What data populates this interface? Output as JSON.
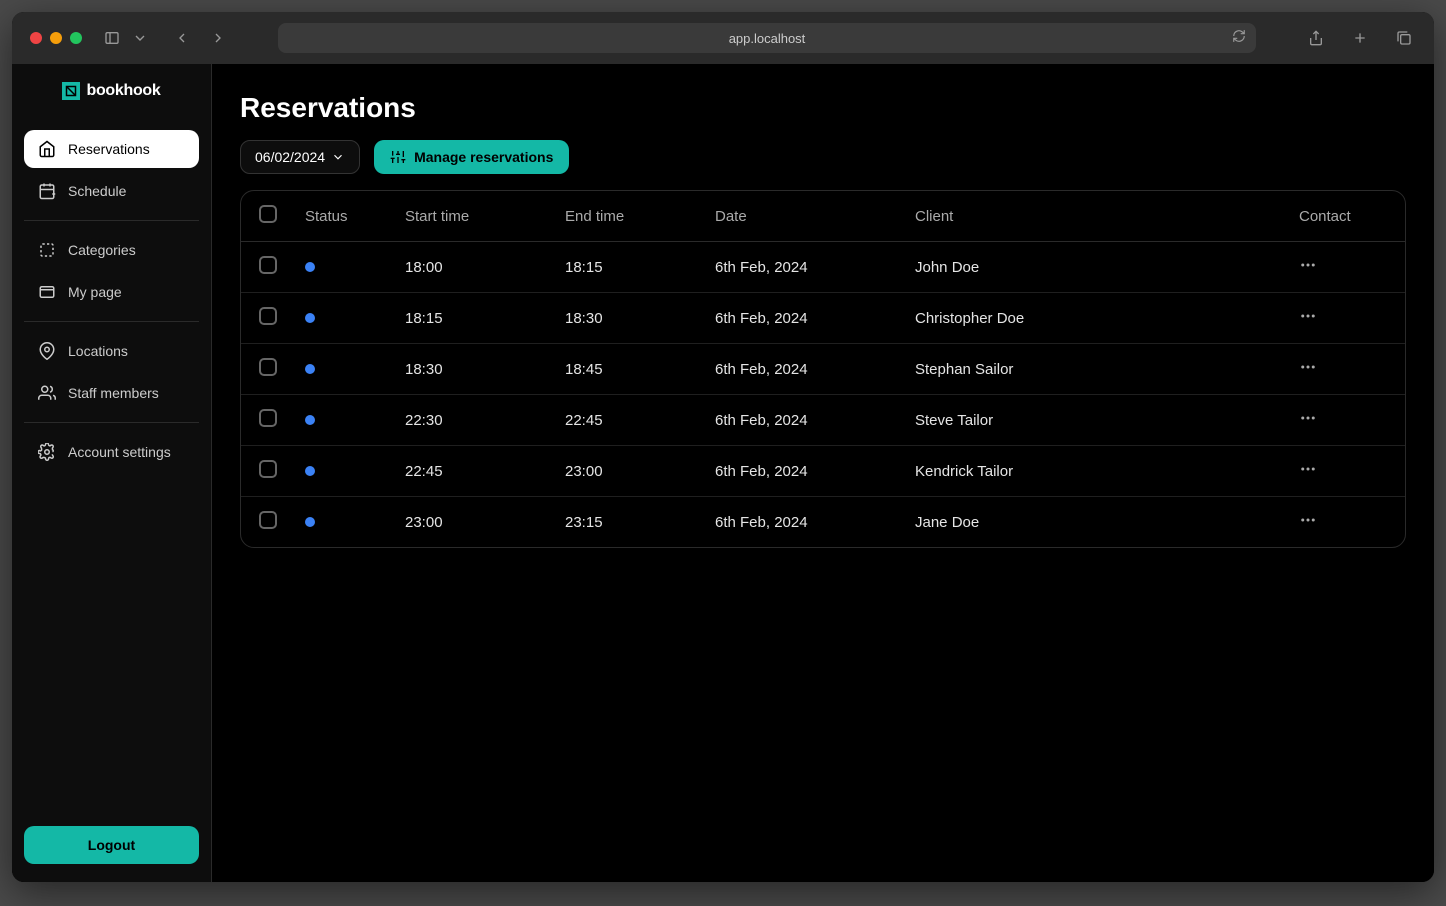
{
  "browser": {
    "url": "app.localhost"
  },
  "brand": {
    "name": "bookhook"
  },
  "sidebar": {
    "items": [
      {
        "label": "Reservations",
        "active": true
      },
      {
        "label": "Schedule",
        "active": false
      },
      {
        "label": "Categories",
        "active": false
      },
      {
        "label": "My page",
        "active": false
      },
      {
        "label": "Locations",
        "active": false
      },
      {
        "label": "Staff members",
        "active": false
      },
      {
        "label": "Account settings",
        "active": false
      }
    ],
    "logout_label": "Logout"
  },
  "page": {
    "title": "Reservations",
    "date_filter": "06/02/2024",
    "manage_label": "Manage reservations"
  },
  "table": {
    "columns": {
      "status": "Status",
      "start": "Start time",
      "end": "End time",
      "date": "Date",
      "client": "Client",
      "contact": "Contact"
    },
    "rows": [
      {
        "start": "18:00",
        "end": "18:15",
        "date": "6th Feb, 2024",
        "client": "John Doe"
      },
      {
        "start": "18:15",
        "end": "18:30",
        "date": "6th Feb, 2024",
        "client": "Christopher Doe"
      },
      {
        "start": "18:30",
        "end": "18:45",
        "date": "6th Feb, 2024",
        "client": "Stephan Sailor"
      },
      {
        "start": "22:30",
        "end": "22:45",
        "date": "6th Feb, 2024",
        "client": "Steve Tailor"
      },
      {
        "start": "22:45",
        "end": "23:00",
        "date": "6th Feb, 2024",
        "client": "Kendrick Tailor"
      },
      {
        "start": "23:00",
        "end": "23:15",
        "date": "6th Feb, 2024",
        "client": "Jane Doe"
      }
    ]
  },
  "colors": {
    "accent": "#14b8a6",
    "status_dot": "#3b82f6"
  }
}
